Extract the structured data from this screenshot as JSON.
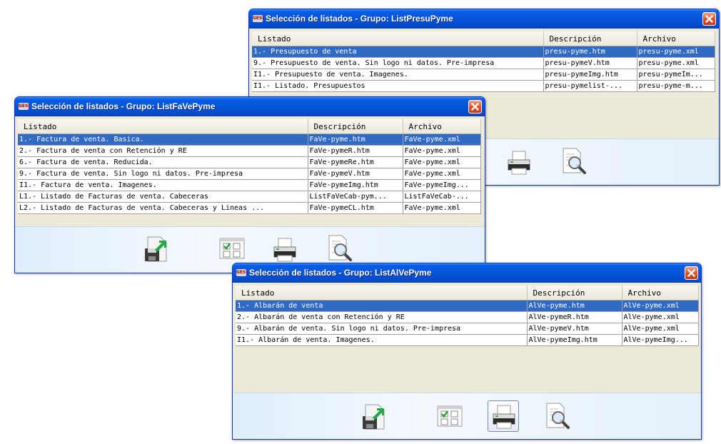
{
  "windows": [
    {
      "title": "Selección de listados - Grupo: ListPresuPyme",
      "columns": [
        "Listado",
        "Descripción",
        "Archivo"
      ],
      "rows": [
        [
          "1.- Presupuesto de venta",
          "presu-pyme.htm",
          "presu-pyme.xml"
        ],
        [
          "9.- Presupuesto de venta. Sin logo ni datos. Pre-impresa",
          "presu-pymeV.htm",
          "presu-pyme.xml"
        ],
        [
          "I1.- Presupuesto de venta. Imagenes.",
          "presu-pymeImg.htm",
          "presu-pymeIm..."
        ],
        [
          "I1.- Listado. Presupuestos",
          "presu-pymelist-...",
          "presu-pyme-m..."
        ]
      ]
    },
    {
      "title": "Selección de listados - Grupo: ListFaVePyme",
      "columns": [
        "Listado",
        "Descripción",
        "Archivo"
      ],
      "rows": [
        [
          "1.- Factura de venta. Basica.",
          "FaVe-pyme.htm",
          "FaVe-pyme.xml"
        ],
        [
          "2.- Factura de venta con Retención y RE",
          "FaVe-pymeR.htm",
          "FaVe-pyme.xml"
        ],
        [
          "6.- Factura de venta. Reducida.",
          "FaVe-pymeRe.htm",
          "FaVe-pyme.xml"
        ],
        [
          "9.- Factura de venta. Sin logo ni datos. Pre-impresa",
          "FaVe-pymeV.htm",
          "FaVe-pyme.xml"
        ],
        [
          "I1.- Factura de venta. Imagenes.",
          "FaVe-pymeImg.htm",
          "FaVe-pymeImg..."
        ],
        [
          "L1.- Listado de Facturas de venta. Cabeceras",
          "ListFaVeCab-pym...",
          "ListFaVeCab-..."
        ],
        [
          "L2.- Listado de Facturas de venta. Cabeceras y Lineas ...",
          "FaVe-pymeCL.htm",
          "FaVe-pyme.xml"
        ]
      ]
    },
    {
      "title": "Selección de listados - Grupo: ListAlVePyme",
      "columns": [
        "Listado",
        "Descripción",
        "Archivo"
      ],
      "rows": [
        [
          "1.- Albarán de venta",
          "AlVe-pyme.htm",
          "AlVe-pyme.xml"
        ],
        [
          "2.- Albarán de venta con Retención y RE",
          "AlVe-pymeR.htm",
          "AlVe-pyme.xml"
        ],
        [
          "9.- Albarán de venta. Sin logo ni datos. Pre-impresa",
          "AlVe-pymeV.htm",
          "AlVe-pyme.xml"
        ],
        [
          "I1.- Albarán de venta. Imagenes.",
          "AlVe-pymeImg.htm",
          "AlVe-pymeImg..."
        ]
      ]
    }
  ],
  "icons": {
    "app": "gesi-app-icon",
    "close": "close-icon",
    "export": "export-icon",
    "select_fields": "select-fields-icon",
    "print": "printer-icon",
    "preview": "print-preview-icon"
  },
  "colors": {
    "titlebar": "#0554d8",
    "selection": "#316ac5",
    "close": "#e2542a",
    "window_bg": "#ece9d8"
  }
}
